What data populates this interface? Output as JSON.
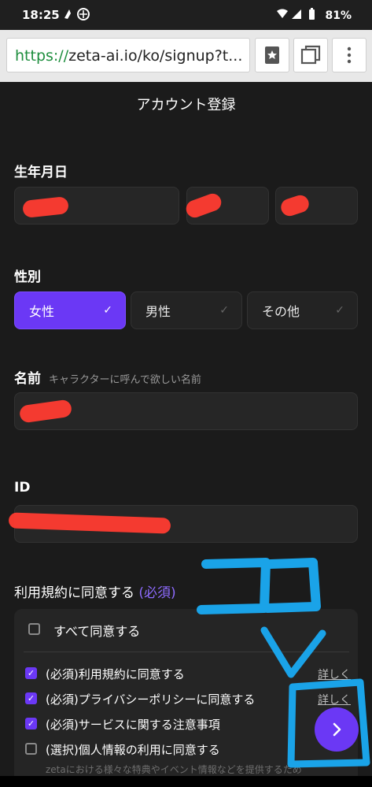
{
  "status_bar": {
    "time": "18:25",
    "battery": "81%"
  },
  "browser": {
    "url_scheme": "https://",
    "url_rest": "zeta-ai.io/ko/signup?t..."
  },
  "page": {
    "title": "アカウント登録"
  },
  "form": {
    "birthdate_label": "生年月日",
    "gender_label": "性別",
    "gender_options": [
      "女性",
      "男性",
      "その他"
    ],
    "gender_selected": "女性",
    "name_label": "名前",
    "name_hint": "キャラクターに呼んで欲しい名前",
    "id_label": "ID"
  },
  "terms": {
    "title": "利用規約に同意する",
    "required_tag": "(必須)",
    "all_label": "すべて同意する",
    "items": [
      {
        "label": "(必須)利用規約に同意する",
        "checked": true,
        "detail": "詳しく"
      },
      {
        "label": "(必須)プライバシーポリシーに同意する",
        "checked": true,
        "detail": "詳しく"
      },
      {
        "label": "(必須)サービスに関する注意事項",
        "checked": true
      },
      {
        "label": "(選択)個人情報の利用に同意する",
        "checked": false
      }
    ],
    "faded_text": "zetaにおける様々な特典やイベント情報などを提供するため"
  },
  "annotation": {
    "text": "ココ",
    "color": "#1aa3e8"
  },
  "colors": {
    "accent": "#6b38f5",
    "redaction": "#ff3b30"
  }
}
